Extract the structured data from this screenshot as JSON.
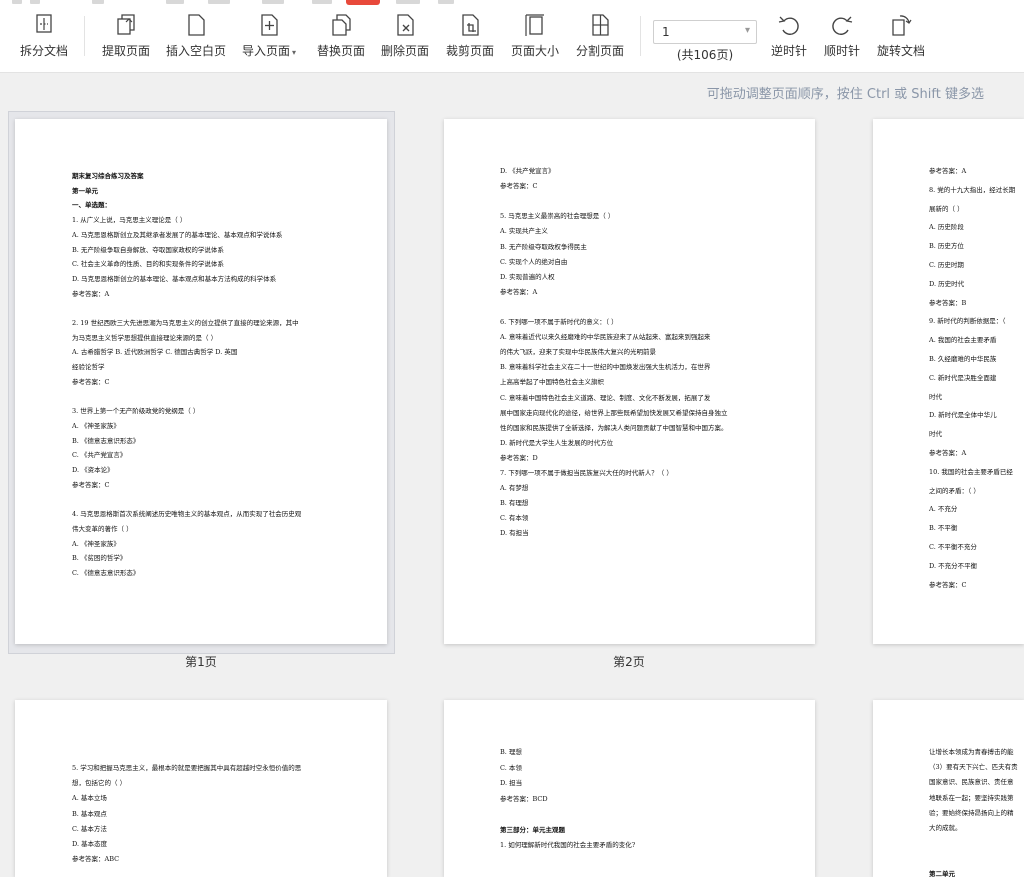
{
  "toolbar": {
    "tools": [
      {
        "id": "split",
        "label": "拆分文档",
        "icon": "split-doc-icon"
      },
      {
        "id": "extract",
        "label": "提取页面",
        "icon": "extract-pages-icon"
      },
      {
        "id": "insert-blank",
        "label": "插入空白页",
        "icon": "blank-page-icon"
      },
      {
        "id": "import",
        "label": "导入页面",
        "icon": "import-page-icon",
        "dropdown": true
      },
      {
        "id": "replace",
        "label": "替换页面",
        "icon": "replace-page-icon"
      },
      {
        "id": "delete",
        "label": "删除页面",
        "icon": "delete-page-icon"
      },
      {
        "id": "crop",
        "label": "裁剪页面",
        "icon": "crop-page-icon"
      },
      {
        "id": "size",
        "label": "页面大小",
        "icon": "page-size-icon"
      },
      {
        "id": "divide",
        "label": "分割页面",
        "icon": "divide-page-icon"
      },
      {
        "id": "ccw",
        "label": "逆时针",
        "icon": "rotate-ccw-icon"
      },
      {
        "id": "cw",
        "label": "顺时针",
        "icon": "rotate-cw-icon"
      },
      {
        "id": "rotate-doc",
        "label": "旋转文档",
        "icon": "rotate-doc-icon"
      }
    ],
    "page_input_value": "1",
    "page_count": "(共106页)",
    "accent_color": "#e8493b"
  },
  "hint": "可拖动调整页面顺序，按住 Ctrl 或 Shift 键多选",
  "pages": [
    {
      "label": "第1页",
      "lines": [
        {
          "t": "期末复习综合练习及答案",
          "b": true
        },
        {
          "t": "第一单元",
          "b": true
        },
        {
          "t": "一、单选题：",
          "b": true
        },
        {
          "t": "1. 从广义上说，马克思主义理论是（    ）"
        },
        {
          "t": "A. 马克思恩格斯创立及其继承者发展了的基本理论、基本观点和学说体系"
        },
        {
          "t": "B. 无产阶级争取自身解放、夺取国家政权的学说体系"
        },
        {
          "t": "C. 社会主义革命的性质、目的和实现条件的学说体系"
        },
        {
          "t": "D. 马克思恩格斯创立的基本理论、基本观点和基本方法构成的科学体系"
        },
        {
          "t": "参考答案：A"
        },
        {
          "t": ""
        },
        {
          "t": "2. 19 世纪西欧三大先进思潮为马克思主义的创立提供了直接的理论来源，其中"
        },
        {
          "t": "为马克思主义哲学思想提供直接理论来源的是（    ）"
        },
        {
          "t": "A. 古希腊哲学          B. 近代欧洲哲学          C. 德国古典哲学          D. 英国"
        },
        {
          "t": "经验论哲学"
        },
        {
          "t": "参考答案：C"
        },
        {
          "t": ""
        },
        {
          "t": "3. 世界上第一个无产阶级政党的党纲是（    ）"
        },
        {
          "t": "A. 《神圣家族》"
        },
        {
          "t": "B. 《德意志意识形态》"
        },
        {
          "t": "C. 《共产党宣言》"
        },
        {
          "t": "D. 《资本论》"
        },
        {
          "t": "参考答案：C"
        },
        {
          "t": ""
        },
        {
          "t": "4. 马克思恩格斯首次系统阐述历史唯物主义的基本观点，从而实现了社会历史观"
        },
        {
          "t": "伟大变革的著作（    ）"
        },
        {
          "t": "A. 《神圣家族》"
        },
        {
          "t": "B. 《贫困的哲学》"
        },
        {
          "t": "C. 《德意志意识形态》"
        }
      ]
    },
    {
      "label": "第2页",
      "lines": [
        {
          "t": "D. 《共产党宣言》"
        },
        {
          "t": "参考答案：C"
        },
        {
          "t": ""
        },
        {
          "t": "5. 马克思主义最崇高的社会理想是（    ）"
        },
        {
          "t": "A. 实现共产主义"
        },
        {
          "t": "B. 无产阶级夺取政权争得民主"
        },
        {
          "t": "C. 实现个人的绝对自由"
        },
        {
          "t": "D. 实现普遍的人权"
        },
        {
          "t": "参考答案：A"
        },
        {
          "t": ""
        },
        {
          "t": "6. 下列哪一项不属于新时代的意义：（    ）"
        },
        {
          "t": "    A. 意味着近代以来久经磨难的中华民族迎来了从站起来、富起来到强起来"
        },
        {
          "t": "的伟大飞跃，迎来了实现中华民族伟大复兴的光明前景"
        },
        {
          "t": "    B. 意味着科学社会主义在二十一世纪的中国焕发出强大生机活力，在世界"
        },
        {
          "t": "上高高举起了中国特色社会主义旗帜"
        },
        {
          "t": "    C. 意味着中国特色社会主义道路、理论、制度、文化不断发展，拓展了发"
        },
        {
          "t": "展中国家走向现代化的途径，给世界上那些既希望加快发展又希望保持自身独立"
        },
        {
          "t": "性的国家和民族提供了全新选择，为解决人类问题贡献了中国智慧和中国方案。"
        },
        {
          "t": "    D. 新时代是大学生人生发展的时代方位"
        },
        {
          "t": "参考答案：D"
        },
        {
          "t": "7. 下列哪一项不属于做担当民族复兴大任的时代新人？（    ）"
        },
        {
          "t": "    A. 有梦想"
        },
        {
          "t": "    B. 有理想"
        },
        {
          "t": "    C. 有本领"
        },
        {
          "t": "    D. 有担当"
        }
      ]
    },
    {
      "label": "",
      "lines": [
        {
          "t": "参考答案：A"
        },
        {
          "t": "8. 党的十九大指出，经过长期"
        },
        {
          "t": "展新的（    ）"
        },
        {
          "t": "    A. 历史阶段"
        },
        {
          "t": "    B. 历史方位"
        },
        {
          "t": "    C. 历史时期"
        },
        {
          "t": "    D. 历史时代"
        },
        {
          "t": "参考答案：B"
        },
        {
          "t": "9. 新时代的判断依据是：（"
        },
        {
          "t": "    A. 我国的社会主要矛盾"
        },
        {
          "t": "    B. 久经磨难的中华民族"
        },
        {
          "t": "    C. 新时代是决胜全面建"
        },
        {
          "t": "时代"
        },
        {
          "t": "    D. 新时代是全体中华儿"
        },
        {
          "t": "时代"
        },
        {
          "t": "参考答案：A"
        },
        {
          "t": "10. 我国的社会主要矛盾已经"
        },
        {
          "t": "之间的矛盾：（    ）"
        },
        {
          "t": "    A. 不充分"
        },
        {
          "t": "    B. 不平衡"
        },
        {
          "t": "    C. 不平衡不充分"
        },
        {
          "t": "    D. 不充分不平衡"
        },
        {
          "t": "参考答案：C"
        }
      ]
    },
    {
      "label": "",
      "lines": [
        {
          "t": "5. 学习和把握马克思主义，最根本的就是要把握其中具有超越时空永恒价值的思"
        },
        {
          "t": "想，包括它的（    ）"
        },
        {
          "t": "A. 基本立场"
        },
        {
          "t": "B. 基本观点"
        },
        {
          "t": "C. 基本方法"
        },
        {
          "t": "D. 基本态度"
        },
        {
          "t": "参考答案：ABC"
        }
      ]
    },
    {
      "label": "",
      "lines": [
        {
          "t": "    B. 理想"
        },
        {
          "t": "    C. 本领"
        },
        {
          "t": "    D. 担当"
        },
        {
          "t": "参考答案：BCD"
        },
        {
          "t": ""
        },
        {
          "t": "第三部分：单元主观题",
          "b": true
        },
        {
          "t": "1. 如何理解新时代我国的社会主要矛盾的变化?"
        }
      ]
    },
    {
      "label": "",
      "lines": [
        {
          "t": "让增长本领成为青春搏击的能"
        },
        {
          "t": "（3）要有天下兴亡、匹夫有责"
        },
        {
          "t": "国家意识、民族意识、责任意"
        },
        {
          "t": "地联系在一起；要坚持实践第"
        },
        {
          "t": "验；要始终保持昂扬向上的精"
        },
        {
          "t": "大的成就。"
        },
        {
          "t": ""
        },
        {
          "t": ""
        },
        {
          "t": "第二单元",
          "b": true
        }
      ]
    }
  ]
}
